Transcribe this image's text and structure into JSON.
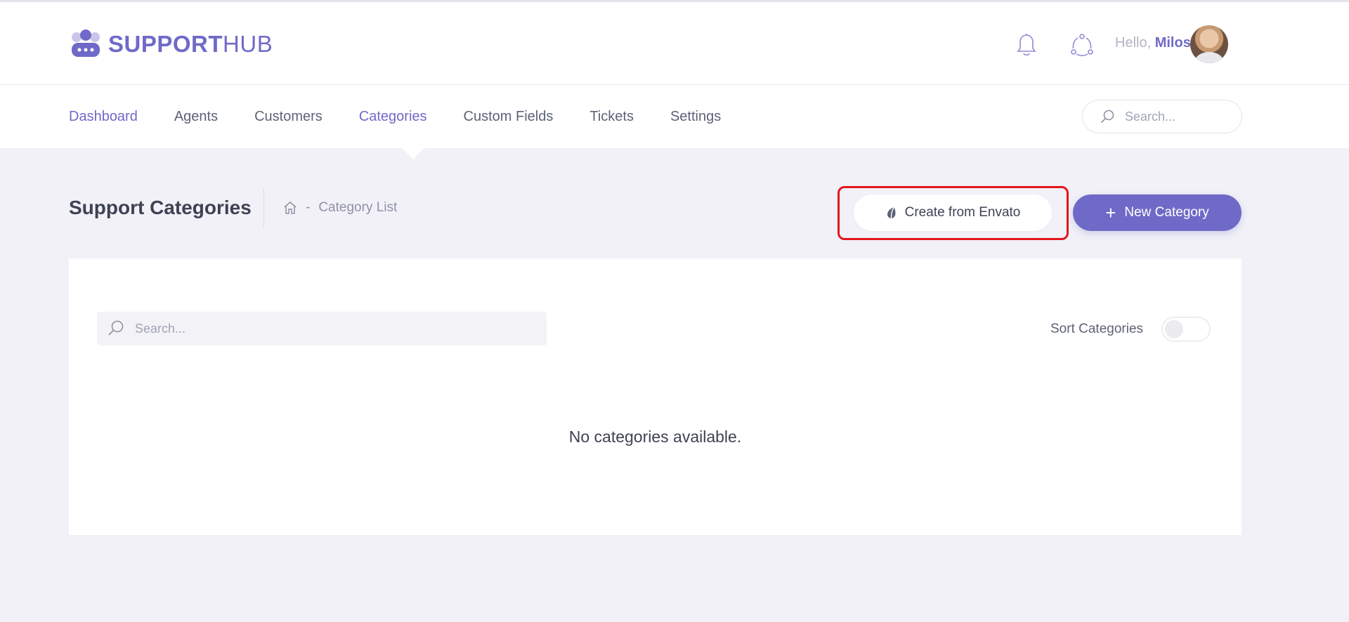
{
  "brand": {
    "logo_bold": "SUPPORT",
    "logo_light": "HUB",
    "accent_color": "#6f6ac7"
  },
  "header": {
    "greeting": "Hello,",
    "user_name": "Milos",
    "icons": [
      "bell-icon",
      "sync-icon"
    ]
  },
  "nav": {
    "items": [
      {
        "label": "Dashboard",
        "active": true
      },
      {
        "label": "Agents",
        "active": false
      },
      {
        "label": "Customers",
        "active": false
      },
      {
        "label": "Categories",
        "active": true
      },
      {
        "label": "Custom Fields",
        "active": false
      },
      {
        "label": "Tickets",
        "active": false
      },
      {
        "label": "Settings",
        "active": false
      }
    ],
    "search_placeholder": "Search..."
  },
  "page": {
    "title": "Support Categories",
    "breadcrumb_separator": "-",
    "breadcrumb_current": "Category List"
  },
  "actions": {
    "create_envato_label": "Create from Envato",
    "new_category_label": "New Category",
    "highlight_color": "#e3161c"
  },
  "content": {
    "search_placeholder": "Search...",
    "sort_label": "Sort Categories",
    "sort_enabled": false,
    "empty_message": "No categories available."
  }
}
